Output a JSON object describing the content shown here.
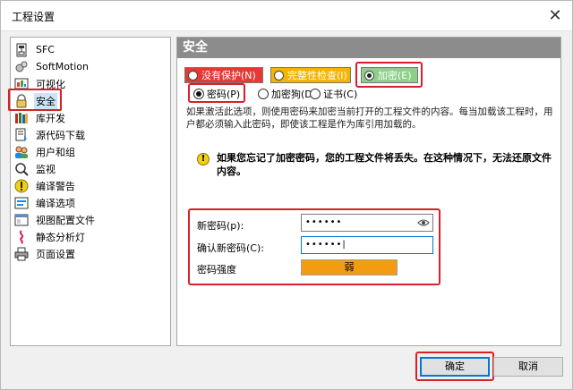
{
  "window": {
    "title": "工程设置",
    "close_glyph": "✕"
  },
  "nav": {
    "items": [
      {
        "label": "SFC",
        "icon": "sfc-icon"
      },
      {
        "label": "SoftMotion",
        "icon": "softmotion-icon"
      },
      {
        "label": "可视化",
        "icon": "visualization-icon"
      },
      {
        "label": "安全",
        "icon": "lock-icon",
        "selected": true
      },
      {
        "label": "库开发",
        "icon": "library-icon"
      },
      {
        "label": "源代码下载",
        "icon": "source-download-icon"
      },
      {
        "label": "用户和组",
        "icon": "users-icon"
      },
      {
        "label": "监视",
        "icon": "monitor-icon"
      },
      {
        "label": "编译警告",
        "icon": "warning-icon"
      },
      {
        "label": "编译选项",
        "icon": "compile-options-icon"
      },
      {
        "label": "视图配置文件",
        "icon": "view-profile-icon"
      },
      {
        "label": "静态分析灯",
        "icon": "static-analysis-icon"
      },
      {
        "label": "页面设置",
        "icon": "printer-icon"
      }
    ]
  },
  "panel": {
    "header": "安全",
    "modes": [
      {
        "label": "没有保护(N)",
        "color": "#e53935",
        "selected": false
      },
      {
        "label": "完整性检查(I)",
        "color": "#f4b400",
        "selected": false
      },
      {
        "label": "加密(E)",
        "color": "#4caf50",
        "selected": true
      }
    ],
    "encryption_types": [
      {
        "label": "密码(P)",
        "selected": true
      },
      {
        "label": "加密狗(D)",
        "selected": false
      },
      {
        "label": "证书(C)",
        "selected": false
      }
    ],
    "description": "如果激活此选项，则使用密码来加密当前打开的工程文件的内容。每当加载该工程时，用户都必须输入此密码，即使该工程是作为库引用加载的。",
    "warning": "如果您忘记了加密密码，您的工程文件将丢失。在这种情况下，无法还原文件内容。",
    "fields": {
      "new_password_label": "新密码(p):",
      "new_password_value": "••••••",
      "confirm_password_label": "确认新密码(C):",
      "confirm_password_value": "••••••|",
      "strength_label": "密码强度",
      "strength_value": "弱"
    }
  },
  "buttons": {
    "ok": "确定",
    "cancel": "取消"
  }
}
